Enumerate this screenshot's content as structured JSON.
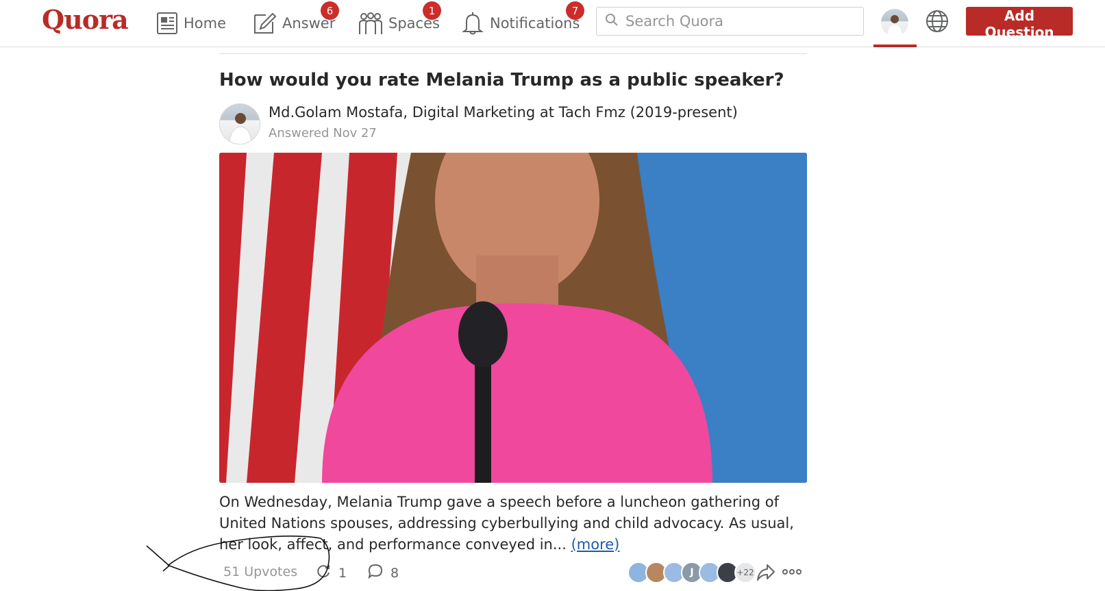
{
  "nav": {
    "logo": "Quora",
    "items": [
      {
        "label": "Home",
        "icon": "home-feed-icon"
      },
      {
        "label": "Answer",
        "icon": "pencil-icon",
        "badge": "6"
      },
      {
        "label": "Spaces",
        "icon": "people-icon",
        "badge": "1"
      },
      {
        "label": "Notifications",
        "icon": "bell-icon",
        "badge": "7"
      }
    ],
    "search_placeholder": "Search Quora",
    "add_question_label": "Add Question",
    "colors": {
      "brand": "#b92b27",
      "badge": "#cb2d2a"
    }
  },
  "post": {
    "question": "How would you rate Melania Trump as a public speaker?",
    "author": "Md.Golam Mostafa, Digital Marketing at Tach Fmz (2019-present)",
    "answered": "Answered Nov 27",
    "excerpt": "On Wednesday, Melania Trump gave a speech before a luncheon gathering of United Nations spouses, addressing cyberbullying and child advocacy. As usual, her look, affect, and performance conveyed in...",
    "more_label": "(more)",
    "upvotes": "51 Upvotes",
    "shares": "1",
    "comments": "8",
    "upvoter_faces": [
      {
        "letter": "",
        "color": "#8fb4e0"
      },
      {
        "letter": "",
        "color": "#b8875f"
      },
      {
        "letter": "",
        "color": "#9bbbe3"
      },
      {
        "letter": "J",
        "color": "#8a9aa8"
      },
      {
        "letter": "",
        "color": "#9bbbe3"
      },
      {
        "letter": "",
        "color": "#3b3f46"
      }
    ],
    "more_faces": "+22"
  }
}
